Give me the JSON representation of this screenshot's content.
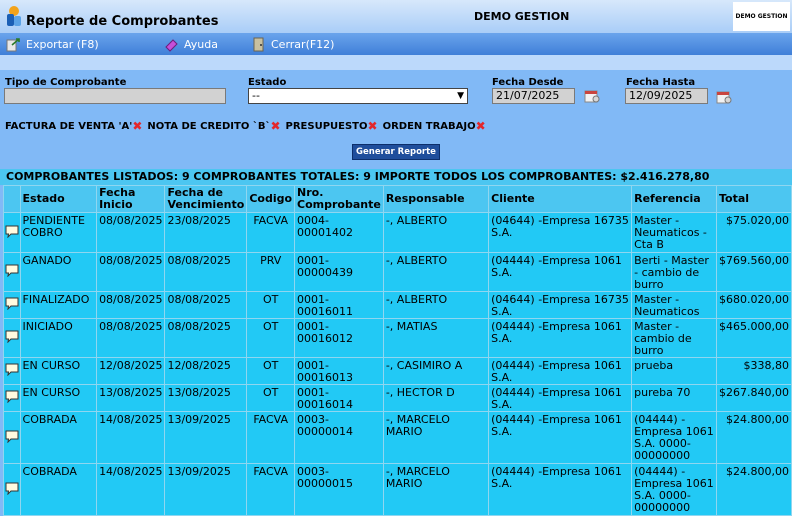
{
  "app": {
    "title": "Reporte de Comprobantes",
    "company": "DEMO GESTION",
    "brand": "DEMO GESTION"
  },
  "menu": [
    {
      "label": "Exportar (F8)",
      "icon": "export-icon"
    },
    {
      "label": "Ayuda",
      "icon": "help-icon"
    },
    {
      "label": "Cerrar(F12)",
      "icon": "close-door-icon"
    }
  ],
  "filters": {
    "tipo_label": "Tipo de Comprobante",
    "tipo_value": "",
    "estado_label": "Estado",
    "estado_value": "--",
    "desde_label": "Fecha Desde",
    "desde_value": "21/07/2025",
    "hasta_label": "Fecha Hasta",
    "hasta_value": "12/09/2025"
  },
  "selected_types": [
    "FACTURA DE VENTA 'A'",
    "NOTA DE CREDITO `B`",
    "PRESUPUESTO",
    "ORDEN TRABAJO"
  ],
  "generate_label": "Generar Reporte",
  "summary": "COMPROBANTES LISTADOS: 9 COMPROBANTES TOTALES: 9 IMPORTE TODOS LOS COMPROBANTES: $2.416.278,80",
  "columns": [
    "Estado",
    "Fecha Inicio",
    "Fecha de Vencimiento",
    "Codigo",
    "Nro. Comprobante",
    "Responsable",
    "Cliente",
    "Referencia",
    "Total"
  ],
  "rows": [
    {
      "estado": "PENDIENTE COBRO",
      "inicio": "08/08/2025",
      "venc": "23/08/2025",
      "codigo": "FACVA",
      "nro": "0004-00001402",
      "resp": "-, ALBERTO",
      "cliente": "(04644) -Empresa 16735 S.A.",
      "ref": "Master - Neumaticos - Cta B",
      "total": "$75.020,00"
    },
    {
      "estado": "GANADO",
      "inicio": "08/08/2025",
      "venc": "08/08/2025",
      "codigo": "PRV",
      "nro": "0001-00000439",
      "resp": "-, ALBERTO",
      "cliente": "(04444) -Empresa 1061 S.A.",
      "ref": "Berti - Master - cambio de burro",
      "total": "$769.560,00"
    },
    {
      "estado": "FINALIZADO",
      "inicio": "08/08/2025",
      "venc": "08/08/2025",
      "codigo": "OT",
      "nro": "0001-00016011",
      "resp": "-, ALBERTO",
      "cliente": "(04644) -Empresa 16735 S.A.",
      "ref": "Master - Neumaticos",
      "total": "$680.020,00"
    },
    {
      "estado": "INICIADO",
      "inicio": "08/08/2025",
      "venc": "08/08/2025",
      "codigo": "OT",
      "nro": "0001-00016012",
      "resp": "-, MATIAS",
      "cliente": "(04444) -Empresa 1061 S.A.",
      "ref": "Master - cambio de burro",
      "total": "$465.000,00"
    },
    {
      "estado": "EN CURSO",
      "inicio": "12/08/2025",
      "venc": "12/08/2025",
      "codigo": "OT",
      "nro": "0001-00016013",
      "resp": "-, CASIMIRO A",
      "cliente": "(04444) -Empresa 1061 S.A.",
      "ref": "prueba",
      "total": "$338,80"
    },
    {
      "estado": "EN CURSO",
      "inicio": "13/08/2025",
      "venc": "13/08/2025",
      "codigo": "OT",
      "nro": "0001-00016014",
      "resp": "-, HECTOR D",
      "cliente": "(04444) -Empresa 1061 S.A.",
      "ref": "pureba 70",
      "total": "$267.840,00"
    },
    {
      "estado": "COBRADA",
      "inicio": "14/08/2025",
      "venc": "13/09/2025",
      "codigo": "FACVA",
      "nro": "0003-00000014",
      "resp": "-, MARCELO MARIO",
      "cliente": "(04444) -Empresa 1061 S.A.",
      "ref": "(04444) - Empresa 1061 S.A. 0000-00000000",
      "total": "$24.800,00"
    },
    {
      "estado": "COBRADA",
      "inicio": "14/08/2025",
      "venc": "13/09/2025",
      "codigo": "FACVA",
      "nro": "0003-00000015",
      "resp": "-, MARCELO MARIO",
      "cliente": "(04444) -Empresa 1061 S.A.",
      "ref": "(04444) - Empresa 1061 S.A. 0000-00000000",
      "total": "$24.800,00"
    }
  ]
}
